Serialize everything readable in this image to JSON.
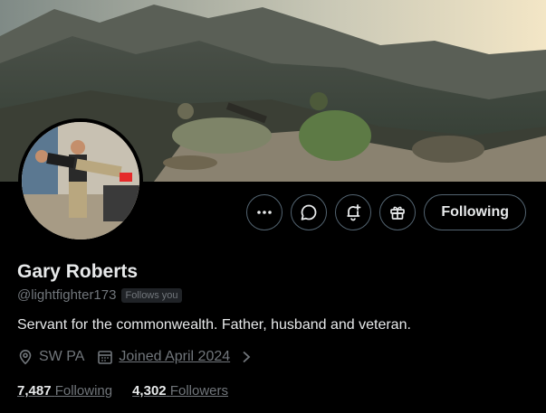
{
  "profile": {
    "name": "Gary Roberts",
    "handle": "@lightfighter173",
    "follows_you": "Follows you",
    "bio": "Servant for the commonwealth. Father, husband and veteran.",
    "location": "SW PA",
    "joined": "Joined April 2024"
  },
  "stats": {
    "following_count": "7,487",
    "following_label": "Following",
    "followers_count": "4,302",
    "followers_label": "Followers"
  },
  "actions": {
    "follow_label": "Following",
    "icons": [
      "more-icon",
      "message-icon",
      "notification-bell-icon",
      "gift-icon"
    ]
  },
  "colors": {
    "background": "#000000",
    "text_primary": "#e7e9ea",
    "text_secondary": "#71767b",
    "button_border": "#536471"
  }
}
